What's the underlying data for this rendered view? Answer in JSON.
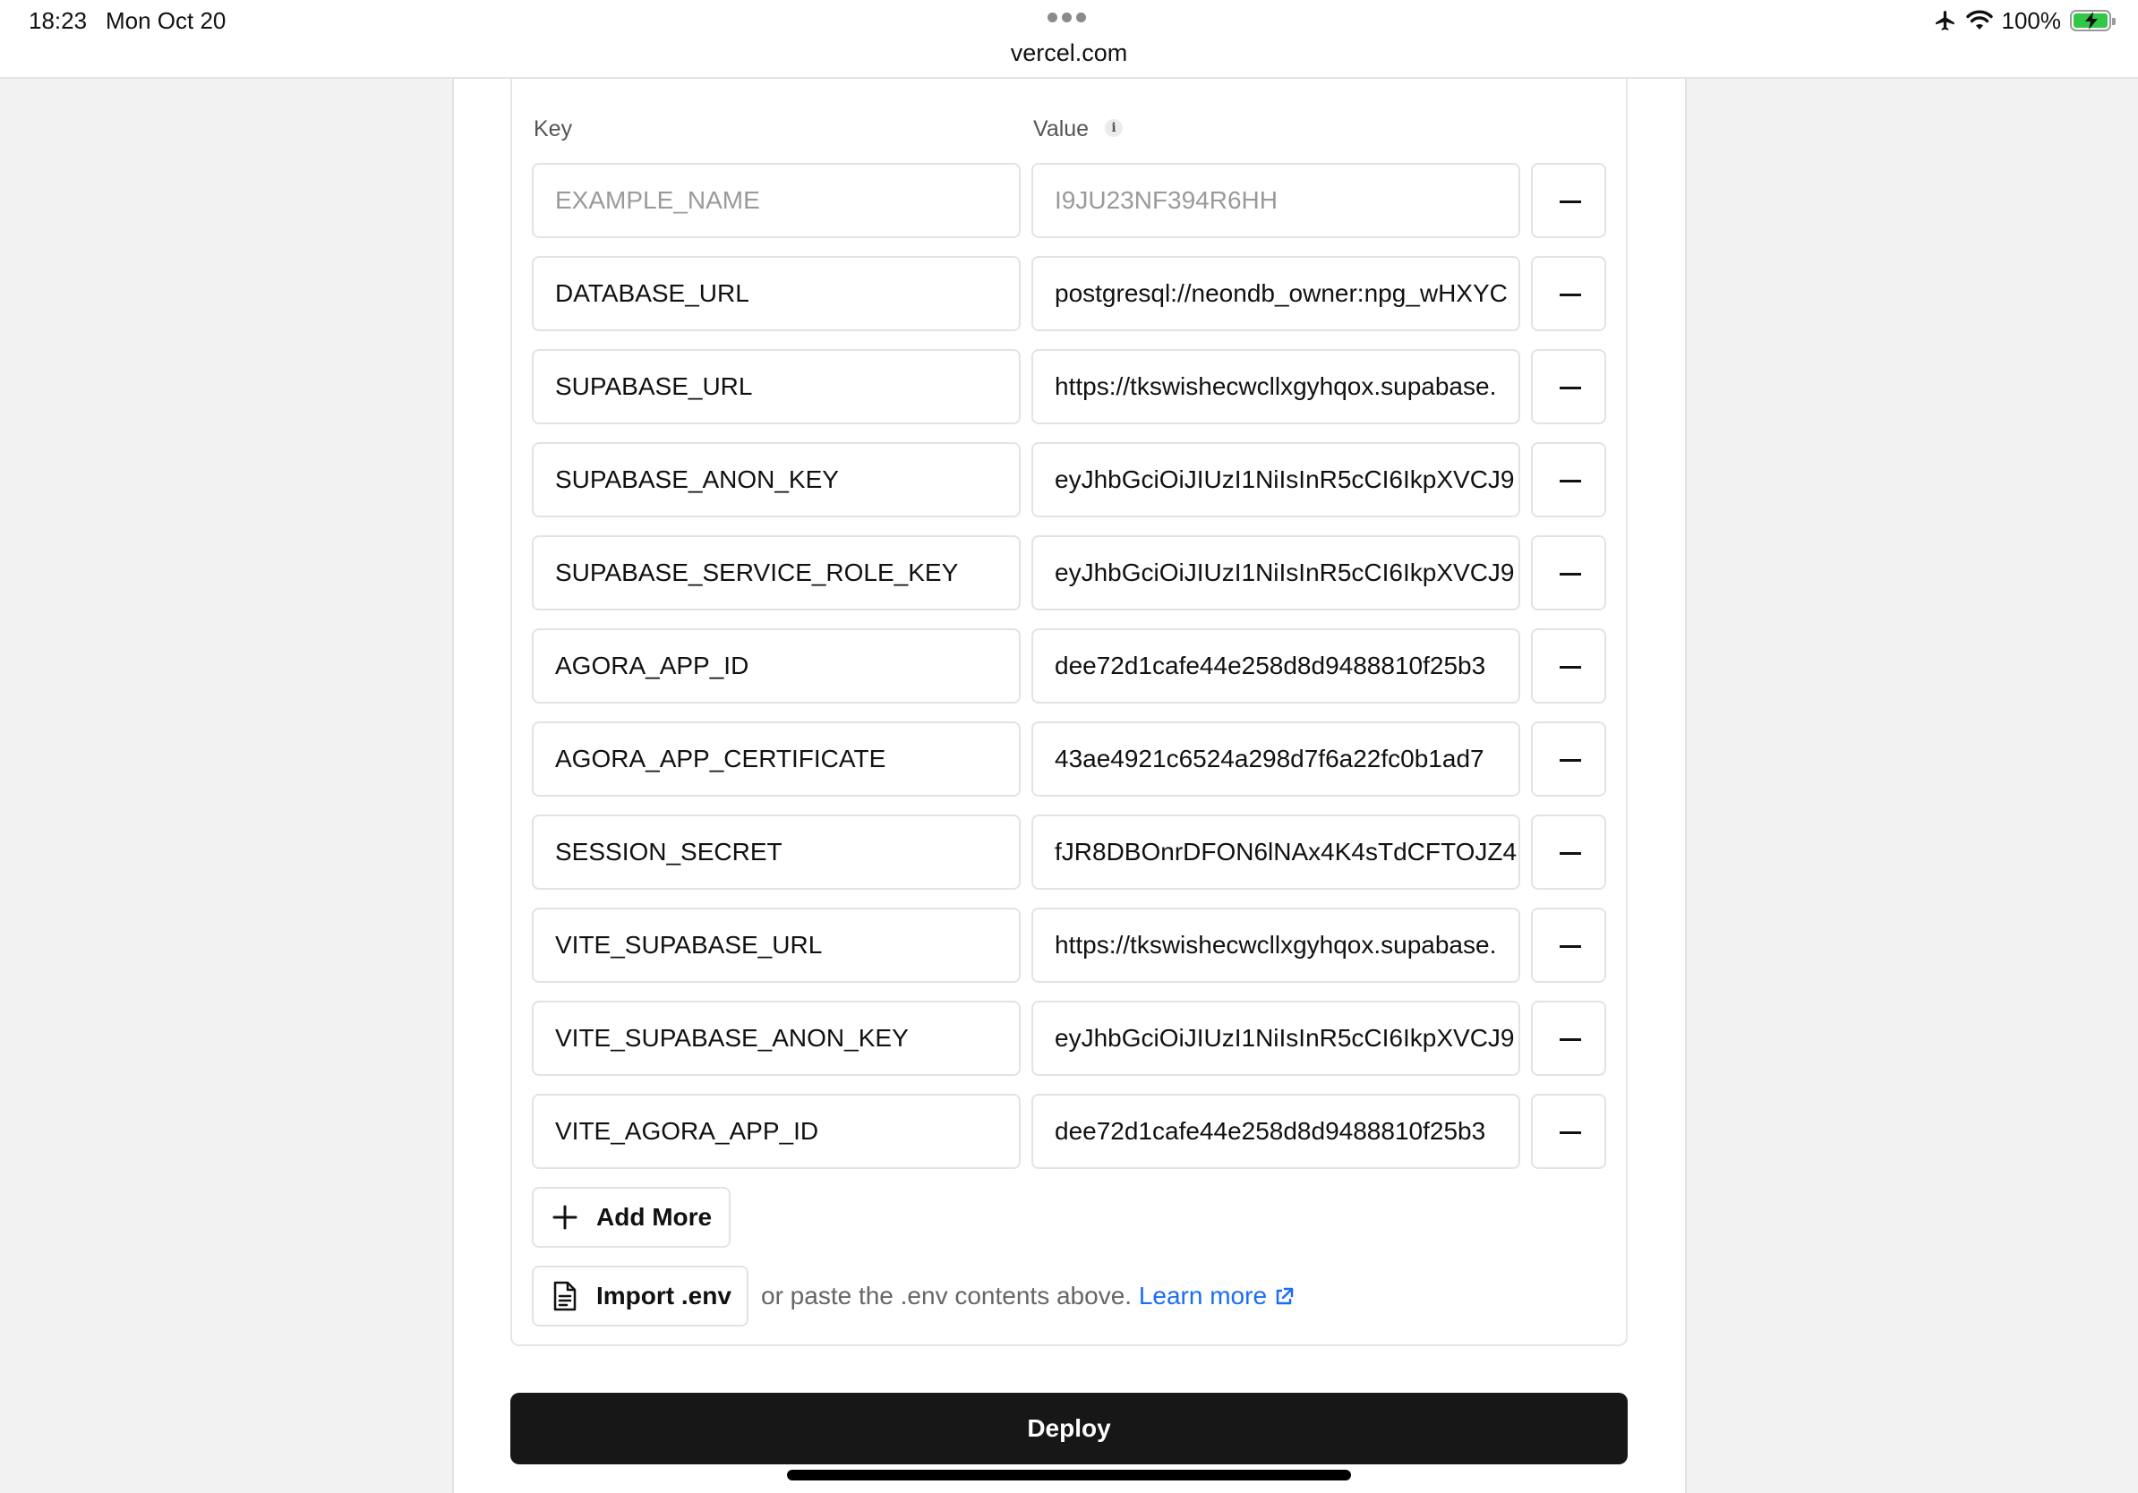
{
  "status_bar": {
    "time": "18:23",
    "date": "Mon Oct 20",
    "url": "vercel.com",
    "battery_percent": "100%",
    "icons": [
      "airplane-icon",
      "wifi-icon",
      "battery-charging-icon",
      "more-dots-icon"
    ]
  },
  "env_form": {
    "key_label": "Key",
    "value_label": "Value",
    "placeholder_row": {
      "key_placeholder": "EXAMPLE_NAME",
      "value_placeholder": "I9JU23NF394R6HH"
    },
    "rows": [
      {
        "key": "DATABASE_URL",
        "value": "postgresql://neondb_owner:npg_wHXYC"
      },
      {
        "key": "SUPABASE_URL",
        "value": "https://tkswishecwcllxgyhqox.supabase."
      },
      {
        "key": "SUPABASE_ANON_KEY",
        "value": "eyJhbGciOiJIUzI1NiIsInR5cCI6IkpXVCJ9"
      },
      {
        "key": "SUPABASE_SERVICE_ROLE_KEY",
        "value": "eyJhbGciOiJIUzI1NiIsInR5cCI6IkpXVCJ9"
      },
      {
        "key": "AGORA_APP_ID",
        "value": "dee72d1cafe44e258d8d9488810f25b3"
      },
      {
        "key": "AGORA_APP_CERTIFICATE",
        "value": "43ae4921c6524a298d7f6a22fc0b1ad7"
      },
      {
        "key": "SESSION_SECRET",
        "value": "fJR8DBOnrDFON6lNAx4K4sTdCFTOJZ4"
      },
      {
        "key": "VITE_SUPABASE_URL",
        "value": "https://tkswishecwcllxgyhqox.supabase."
      },
      {
        "key": "VITE_SUPABASE_ANON_KEY",
        "value": "eyJhbGciOiJIUzI1NiIsInR5cCI6IkpXVCJ9"
      },
      {
        "key": "VITE_AGORA_APP_ID",
        "value": "dee72d1cafe44e258d8d9488810f25b3"
      }
    ],
    "add_more_label": "Add More",
    "import_env_label": "Import .env",
    "paste_hint": "or paste the .env contents above.",
    "learn_more_label": "Learn more"
  },
  "deploy_label": "Deploy",
  "colors": {
    "link": "#1a6ef0",
    "deploy_bg": "#171717",
    "battery": "#33c748"
  }
}
